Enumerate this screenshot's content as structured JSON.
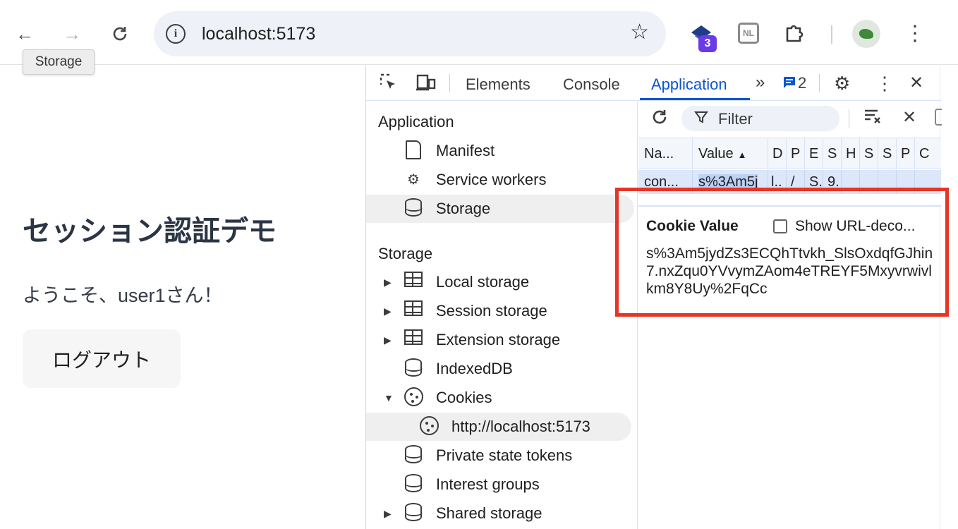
{
  "browser": {
    "url": "localhost:5173",
    "extension_badge": "3",
    "nl_icon_text": "NL",
    "tooltip": "Storage"
  },
  "page": {
    "title": "セッション認証デモ",
    "welcome": "ようこそ、user1さん！",
    "logout_label": "ログアウト"
  },
  "devtools": {
    "tabs": [
      "Elements",
      "Console",
      "Application"
    ],
    "active_tab": "Application",
    "issues_count": "2",
    "sidebar": {
      "application_header": "Application",
      "application_items": [
        "Manifest",
        "Service workers",
        "Storage"
      ],
      "storage_header": "Storage",
      "storage_items": [
        "Local storage",
        "Session storage",
        "Extension storage",
        "IndexedDB",
        "Cookies",
        "http://localhost:5173",
        "Private state tokens",
        "Interest groups",
        "Shared storage"
      ]
    },
    "filter_placeholder": "Filter",
    "table": {
      "headers": [
        "Na...",
        "Value",
        "D",
        "P",
        "E",
        "S",
        "H",
        "S",
        "S",
        "P",
        "C"
      ],
      "row": [
        "con...",
        "s%3Am5j",
        "l..",
        "/",
        "S.",
        "9."
      ]
    },
    "cookie_value": {
      "title": "Cookie Value",
      "show_decoded_label": "Show URL-deco...",
      "value": "s%3Am5jydZs3ECQhTtvkh_SlsOxdqfGJhin7.nxZqu0YVvymZAom4eTREYF5Mxyvrwivlkm8Y8Uy%2FqCc"
    }
  },
  "colors": {
    "accent": "#0b57d0",
    "highlight_border": "#e53527",
    "selected_row": "#dde7fa"
  }
}
